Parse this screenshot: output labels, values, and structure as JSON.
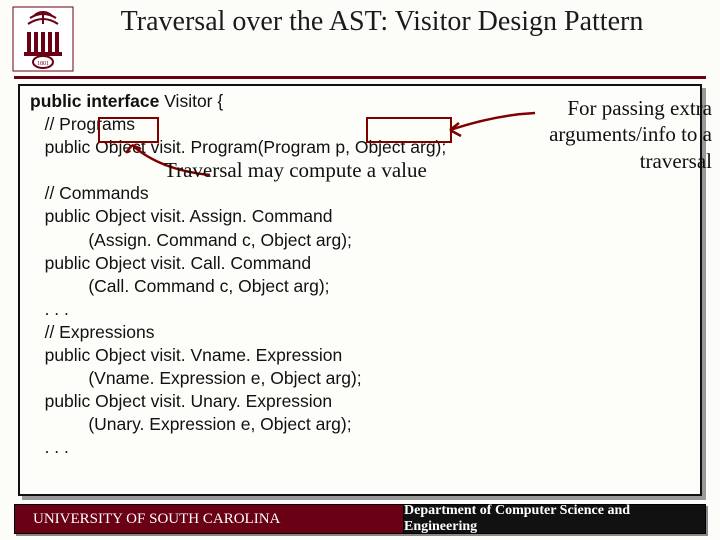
{
  "title": "Traversal over the AST: Visitor Design Pattern",
  "code": {
    "l1a": "public interface ",
    "l1b": "Visitor {",
    "l2": "   // Programs",
    "l3": "   public Object visit. Program(Program p, Object arg);",
    "l4": "",
    "l5": "   // Commands",
    "l6": "   public Object visit. Assign. Command",
    "l7": "            (Assign. Command c, Object arg);",
    "l8": "   public Object visit. Call. Command",
    "l9": "            (Call. Command c, Object arg);",
    "l10": "   . . .",
    "l11": "   // Expressions",
    "l12": "   public Object visit. Vname. Expression",
    "l13": "            (Vname. Expression e, Object arg);",
    "l14": "   public Object visit. Unary. Expression",
    "l15": "            (Unary. Expression e, Object arg);",
    "l16": "   . . ."
  },
  "annotations": {
    "traversal": "Traversal may compute a value",
    "passing": "For passing extra arguments/info to a traversal"
  },
  "footer": {
    "left": "UNIVERSITY OF SOUTH CAROLINA",
    "right": "Department of Computer Science and Engineering"
  }
}
